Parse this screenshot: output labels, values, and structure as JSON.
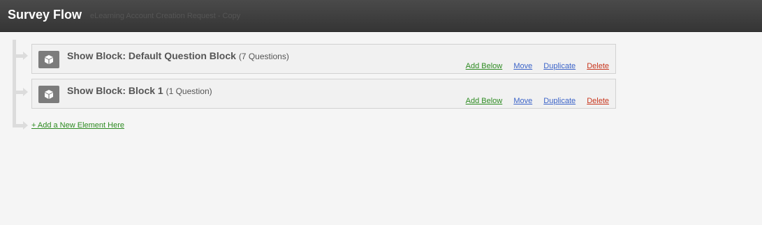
{
  "header": {
    "title": "Survey Flow",
    "subtitle": "eLearning Account Creation Request - Copy"
  },
  "blocks": [
    {
      "title": "Show Block: Default Question Block",
      "count": "(7 Questions)",
      "actions": {
        "add_below": "Add Below",
        "move": "Move",
        "duplicate": "Duplicate",
        "delete": "Delete"
      }
    },
    {
      "title": "Show Block: Block 1",
      "count": "(1 Question)",
      "actions": {
        "add_below": "Add Below",
        "move": "Move",
        "duplicate": "Duplicate",
        "delete": "Delete"
      }
    }
  ],
  "add_element_label": "+ Add a New Element Here",
  "icons": {
    "block": "cube-icon",
    "flow": "arrow-right-icon"
  },
  "colors": {
    "header_bg": "#3f3f3f",
    "page_bg": "#f5f5f5",
    "add": "#2e8b22",
    "link": "#3b63c8",
    "delete": "#c8361d"
  }
}
